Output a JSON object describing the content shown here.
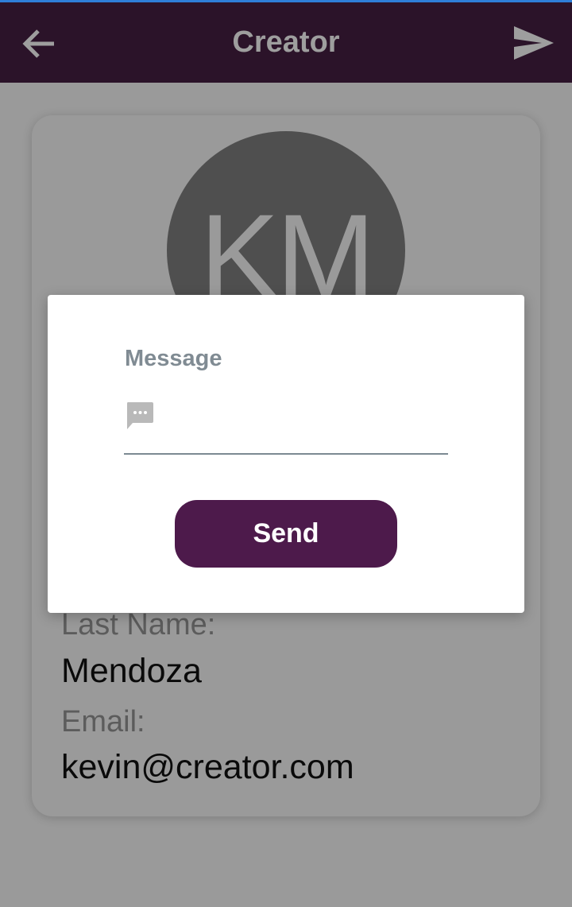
{
  "app_bar": {
    "title": "Creator",
    "back_icon": "arrow-left-icon",
    "action_icon": "send-icon"
  },
  "profile": {
    "initials": "KM",
    "last_name_label": "Last Name:",
    "last_name_value": "Mendoza",
    "email_label": "Email:",
    "email_value": "kevin@creator.com"
  },
  "dialog": {
    "message_label": "Message",
    "message_value": "",
    "message_icon": "chat-bubble-icon",
    "send_label": "Send"
  },
  "colors": {
    "app_bar_bg": "#2b1329",
    "accent_button": "#4d1a4b",
    "scrim": "#9a9a9a",
    "avatar_bg": "#4f4f4f",
    "top_strip": "#2f7fd8"
  }
}
